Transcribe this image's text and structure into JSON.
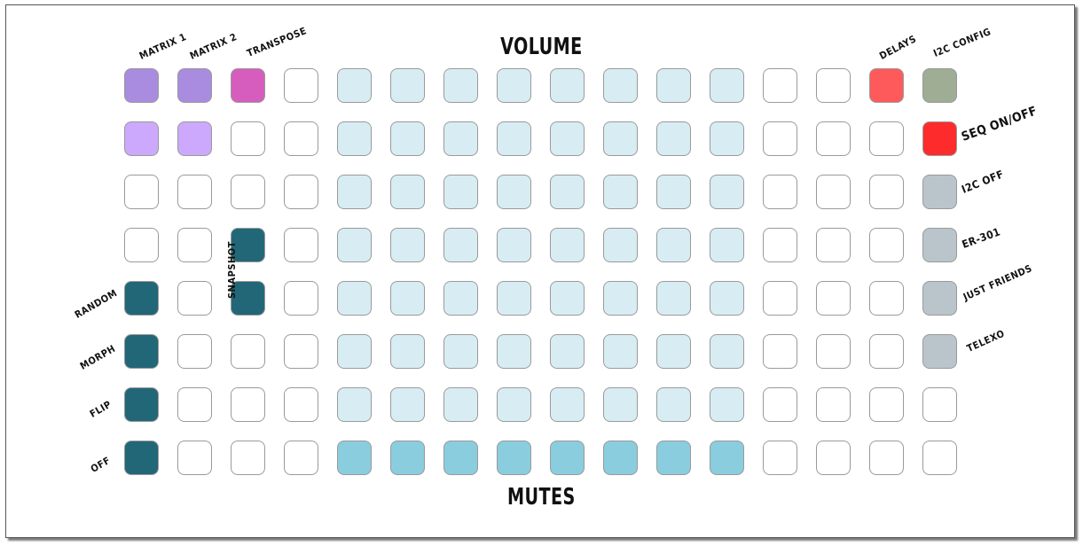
{
  "titles": {
    "volume": "VOLUME",
    "mutes": "MUTES"
  },
  "labels": {
    "matrix1": "MATRIX 1",
    "matrix2": "MATRIX 2",
    "transpose": "TRANSPOSE",
    "delays": "DELAYS",
    "i2c_config": "I2C CONFIG",
    "seq_on_off": "SEQ ON/OFF",
    "i2c_off": "I2C OFF",
    "er301": "ER-301",
    "just_friends": "JUST FRIENDS",
    "telexo": "TELEXO",
    "snapshot": "SNAPSHOT",
    "random": "RANDOM",
    "morph": "MORPH",
    "flip": "FLIP",
    "off": "OFF"
  },
  "colors": {
    "empty": "#ffffff",
    "matrix_active": "#a98be0",
    "matrix_dim": "#cca9fc",
    "transpose": "#d65dbd",
    "volume": "#d8edf3",
    "mute": "#8acdde",
    "control": "#226777",
    "delays": "#fe5a5b",
    "i2c_config": "#9ead94",
    "seq_on_off": "#fe2b2c",
    "i2c_device": "#b9c5ca"
  },
  "grid": {
    "columns": 16,
    "rows": [
      [
        "matrix_active",
        "matrix_active",
        "transpose",
        "empty",
        "volume",
        "volume",
        "volume",
        "volume",
        "volume",
        "volume",
        "volume",
        "volume",
        "empty",
        "empty",
        "delays",
        "i2c_config"
      ],
      [
        "matrix_dim",
        "matrix_dim",
        "empty",
        "empty",
        "volume",
        "volume",
        "volume",
        "volume",
        "volume",
        "volume",
        "volume",
        "volume",
        "empty",
        "empty",
        "empty",
        "seq_on_off"
      ],
      [
        "empty",
        "empty",
        "empty",
        "empty",
        "volume",
        "volume",
        "volume",
        "volume",
        "volume",
        "volume",
        "volume",
        "volume",
        "empty",
        "empty",
        "empty",
        "i2c_device"
      ],
      [
        "empty",
        "empty",
        "control",
        "empty",
        "volume",
        "volume",
        "volume",
        "volume",
        "volume",
        "volume",
        "volume",
        "volume",
        "empty",
        "empty",
        "empty",
        "i2c_device"
      ],
      [
        "control",
        "empty",
        "control",
        "empty",
        "volume",
        "volume",
        "volume",
        "volume",
        "volume",
        "volume",
        "volume",
        "volume",
        "empty",
        "empty",
        "empty",
        "i2c_device"
      ],
      [
        "control",
        "empty",
        "empty",
        "empty",
        "volume",
        "volume",
        "volume",
        "volume",
        "volume",
        "volume",
        "volume",
        "volume",
        "empty",
        "empty",
        "empty",
        "i2c_device"
      ],
      [
        "control",
        "empty",
        "empty",
        "empty",
        "volume",
        "volume",
        "volume",
        "volume",
        "volume",
        "volume",
        "volume",
        "volume",
        "empty",
        "empty",
        "empty",
        "empty"
      ],
      [
        "control",
        "empty",
        "empty",
        "empty",
        "mute",
        "mute",
        "mute",
        "mute",
        "mute",
        "mute",
        "mute",
        "mute",
        "empty",
        "empty",
        "empty",
        "empty"
      ]
    ]
  }
}
